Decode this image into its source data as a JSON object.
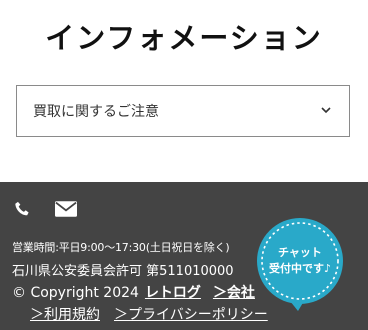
{
  "header": {
    "title": "インフォメーション"
  },
  "select": {
    "label": "買取に関するご注意"
  },
  "footer": {
    "icons": [
      "phone-icon",
      "mail-icon"
    ],
    "hours": "営業時間:平日9:00〜17:30(土日祝日を除く)",
    "license": "石川県公安委員会許可 第511010000",
    "copyright_prefix": "© Copyright 2024",
    "brand": "レトログ",
    "company_link": "＞会社",
    "links": {
      "terms": "＞利用規約",
      "privacy": "＞プライバシーポリシー"
    }
  },
  "chat": {
    "line1": "チャット",
    "line2": "受付中です♪"
  },
  "colors": {
    "footer_bg": "#444444",
    "chat_bg": "#29a9c9"
  }
}
